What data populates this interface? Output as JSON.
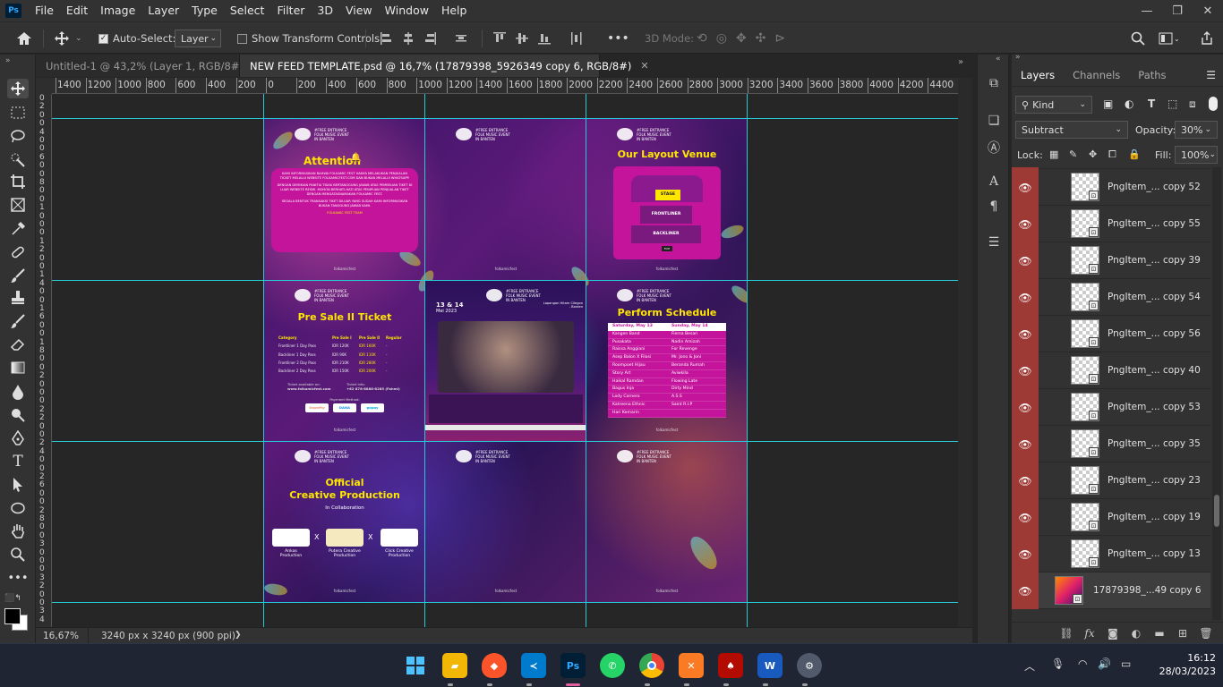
{
  "app": {
    "logo": "Ps",
    "accent": "#31a8ff"
  },
  "menu": [
    "File",
    "Edit",
    "Image",
    "Layer",
    "Type",
    "Select",
    "Filter",
    "3D",
    "View",
    "Window",
    "Help"
  ],
  "window_controls": {
    "minimize": "—",
    "restore": "❐",
    "close": "✕"
  },
  "options_bar": {
    "auto_select_label": "Auto-Select:",
    "auto_select_value": "Layer",
    "transform_controls_label": "Show Transform Controls",
    "more_label": "•••",
    "mode_3d_label": "3D Mode:"
  },
  "tabs": [
    {
      "label": "Untitled-1 @ 43,2% (Layer 1, RGB/8#) *",
      "close": "✕"
    },
    {
      "label": "NEW FEED TEMPLATE.psd @ 16,7% (17879398_5926349 copy 6, RGB/8#)",
      "close": "✕"
    }
  ],
  "ruler_top": [
    "1400",
    "1200",
    "1000",
    "800",
    "600",
    "400",
    "200",
    "0",
    "200",
    "400",
    "600",
    "800",
    "1000",
    "1200",
    "1400",
    "1600",
    "1800",
    "2000",
    "2200",
    "2400",
    "2600",
    "2800",
    "3000",
    "3200",
    "3400",
    "3600",
    "3800",
    "4000",
    "4200",
    "4400",
    "46"
  ],
  "ruler_left": [
    "0",
    "2",
    "0",
    "0",
    "4",
    "0",
    "0",
    "6",
    "0",
    "0",
    "8",
    "0",
    "0",
    "1",
    "0",
    "0",
    "0",
    "1",
    "2",
    "0",
    "0",
    "1",
    "4",
    "0",
    "0",
    "1",
    "6",
    "0",
    "0",
    "1",
    "8",
    "0",
    "0",
    "2",
    "0",
    "0",
    "0",
    "2",
    "2",
    "0",
    "0",
    "2",
    "4",
    "0",
    "0",
    "2",
    "6",
    "0",
    "0",
    "2",
    "8",
    "0",
    "0",
    "3",
    "0",
    "0",
    "0",
    "3",
    "2",
    "0",
    "0",
    "3",
    "4"
  ],
  "artwork": {
    "header_lines": [
      "#FREE ENTRANCE",
      "FOLK MUSIC EVENT",
      "IN BANTEN"
    ],
    "footer": "folkamicfest",
    "attention": {
      "title": "Attention",
      "body1": "KAMI INFORMASIKAN BAHWA FOLKAMIC FEST HANYA MELAKUKAN PENJUALAN TICKET MELALUI WEBSITE FOLKAMICFEST.COM DAN BUKAN MELALUI WHATSAPP.",
      "body2": "DENGAN DEMIKIAN PANITIA TIDAK BERTANGGUNG JAWAB ATAS PEMBELIAN TIKET DI LUAR WEBSITE RESMI. MOHON BERHATI-HATI ATAS PENIPUAN PENJUALAN TIKET DENGAN MENGATASNAMAKAN FOLKAMIC FEST.",
      "body3": "SEGALA BENTUK TRANSAKSI TIKET DILUAR YANG SUDAH KAMI INFORMASIKAN BUKAN TANGGUNG JAWAB KAMI.",
      "sign": "FOLKAMIC FEST TEAM"
    },
    "venue": {
      "title": "Our Layout Venue",
      "stage": "STAGE",
      "frontliner": "FRONTLINER",
      "backliner": "BACKLINER",
      "foh": "FOH"
    },
    "ticket": {
      "title": "Pre Sale II Ticket",
      "headers": [
        "Category",
        "Pre Sale I",
        "Pre Sale II",
        "Regular"
      ],
      "rows": [
        [
          "Frontliner 1 Day Pass",
          "IDR 120K",
          "IDR 160K",
          "-"
        ],
        [
          "Backliner 1 Day Pass",
          "IDR 90K",
          "IDR 110K",
          "-"
        ],
        [
          "Frontliner 2 Day Pass",
          "IDR 210K",
          "IDR 280K",
          "-"
        ],
        [
          "Backliner 2 Day Pass",
          "IDR 150K",
          "IDR 200K",
          "-"
        ]
      ],
      "available": "Ticket available on:",
      "site": "www.folkamicfest.com",
      "info": "Ticket info:",
      "phone": "+62 878-8888-8285 (Fahmi)",
      "payment": "Payment Method:",
      "methods": [
        "ShopeePay",
        "DANA",
        "gopay"
      ]
    },
    "poster": {
      "date": "13 & 14",
      "month": "Mei 2023",
      "venue": "Lapangan Hitam Cilegon - Banten"
    },
    "schedule": {
      "title": "Perform Schedule",
      "day1": "Saturday, May 13",
      "day2": "Sunday, May 14",
      "rows": [
        [
          "Kangen Band",
          "Fiersa Besari"
        ],
        [
          "Pusakata",
          "Nadin Amizah"
        ],
        [
          "Raissa Anggiani",
          "For Revenge"
        ],
        [
          "Asep Balon X Filosi",
          "Mr. Jono & Joni"
        ],
        [
          "Roompoet Hijau",
          "Beranda Rumah"
        ],
        [
          "Story Art",
          "Aviwkila"
        ],
        [
          "Haikal Ramdan",
          "Flowing Late"
        ],
        [
          "Bagus Inja",
          "Dirty Mind"
        ],
        [
          "Lody Cornero",
          "A.S.S"
        ],
        [
          "Katreena Ethnic",
          "Saint R.I.P"
        ],
        [
          "Hari Kemarin",
          ""
        ]
      ]
    },
    "collab": {
      "title1": "Official",
      "title2": "Creative Production",
      "subtitle": "In Collaboration",
      "x": "X",
      "partners": [
        {
          "name1": "Ankas",
          "name2": "Production"
        },
        {
          "name1": "Putera Creative",
          "name2": "Production"
        },
        {
          "name1": "Click Creative",
          "name2": "Production"
        }
      ]
    }
  },
  "panel": {
    "tabs": [
      "Layers",
      "Channels",
      "Paths"
    ],
    "kind": "Kind",
    "blend_mode": "Subtract",
    "opacity_label": "Opacity:",
    "opacity_value": "30%",
    "lock_label": "Lock:",
    "fill_label": "Fill:",
    "fill_value": "100%",
    "layers": [
      "PngItem_... copy 52",
      "PngItem_... copy 55",
      "PngItem_... copy 39",
      "PngItem_... copy 54",
      "PngItem_... copy 56",
      "PngItem_... copy 40",
      "PngItem_... copy 53",
      "PngItem_... copy 35",
      "PngItem_... copy 23",
      "PngItem_... copy 19",
      "PngItem_... copy 13",
      "17879398_...49 copy 6"
    ],
    "selected_index": 11,
    "footer_icons": [
      "link-icon",
      "fx-icon",
      "mask-icon",
      "adjustment-icon",
      "folder-icon",
      "new-layer-icon",
      "trash-icon"
    ]
  },
  "status": {
    "zoom": "16,67%",
    "doc_info": "3240 px x 3240 px (900 ppi)",
    "arrow": "❯"
  },
  "taskbar": {
    "apps": [
      "start",
      "file-explorer",
      "brave",
      "vscode",
      "photoshop",
      "whatsapp",
      "chrome",
      "xampp",
      "acrobat",
      "word",
      "settings"
    ],
    "time": "16:12",
    "date": "28/03/2023"
  },
  "colors": {
    "guide": "#27c9d6",
    "eye_bg": "#9e3a35",
    "card_pink": "#c4149c",
    "title_yellow": "#ffe600"
  }
}
